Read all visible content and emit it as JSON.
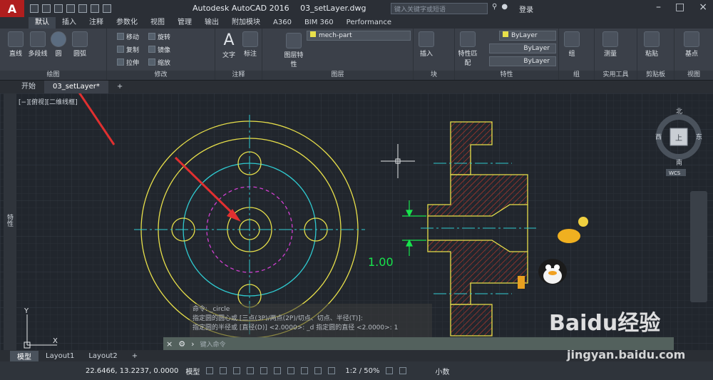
{
  "titlebar": {
    "app": "Autodesk AutoCAD 2016",
    "file": "03_setLayer.dwg",
    "search_placeholder": "键入关键字或短语",
    "login": "登录"
  },
  "ribbon_tabs": [
    "默认",
    "插入",
    "注释",
    "参数化",
    "视图",
    "管理",
    "输出",
    "附加模块",
    "A360",
    "BIM 360",
    "Performance"
  ],
  "draw_panel": {
    "line": "直线",
    "polyline": "多段线",
    "circle": "圆",
    "arc": "圆弧",
    "title": "绘图"
  },
  "modify_panel": {
    "move": "移动",
    "rotate": "旋转",
    "copy": "复制",
    "mirror": "镜像",
    "stretch": "拉伸",
    "scale": "缩放",
    "title": "修改"
  },
  "annotation_panel": {
    "text": "文字",
    "dimension": "标注",
    "title": "注释"
  },
  "layers_panel": {
    "layer_props": "图层特性",
    "current_layer": "mech-part",
    "title": "图层"
  },
  "block_panel": {
    "insert": "插入",
    "title": "块"
  },
  "properties_panel": {
    "match": "特性匹配",
    "bylayer1": "ByLayer",
    "bylayer2": "ByLayer",
    "bylayer3": "ByLayer",
    "title": "特性"
  },
  "group_panel": {
    "group": "组",
    "title": "组"
  },
  "utilities_panel": {
    "measure": "测量",
    "title": "实用工具"
  },
  "clipboard_panel": {
    "paste": "粘贴",
    "title": "剪贴板"
  },
  "view_panel": {
    "base": "基点",
    "title": "视图"
  },
  "doc_tabs": {
    "start": "开始",
    "file": "03_setLayer*"
  },
  "viewport_label": "[−][俯视][二维线框]",
  "viewcube": {
    "north": "北",
    "south": "南",
    "east": "东",
    "west": "西",
    "top": "上",
    "wcs": "WCS"
  },
  "side_palette": "特性",
  "dimension_value": "1.00",
  "command_history": [
    "命令: _circle",
    "指定圆的圆心或 [三点(3P)/两点(2P)/切点、切点、半径(T)]:",
    "指定圆的半径或 [直径(D)] <2.0000>: _d 指定圆的直径 <2.0000>: 1"
  ],
  "command_prompt": "键入命令",
  "layout_tabs": [
    "模型",
    "Layout1",
    "Layout2"
  ],
  "status": {
    "coords": "22.6466, 13.2237, 0.0000",
    "model": "模型",
    "scale": "1:2 / 50%",
    "units": "小数"
  },
  "watermark": {
    "brand": "Baidu经验",
    "url": "jingyan.baidu.com"
  },
  "colors": {
    "yellow": "#e8e04a",
    "cyan": "#2fc9cf",
    "magenta": "#d03fd0",
    "hatch": "#c0392b",
    "dim_green": "#17e44c",
    "arrow_red": "#e03030"
  }
}
